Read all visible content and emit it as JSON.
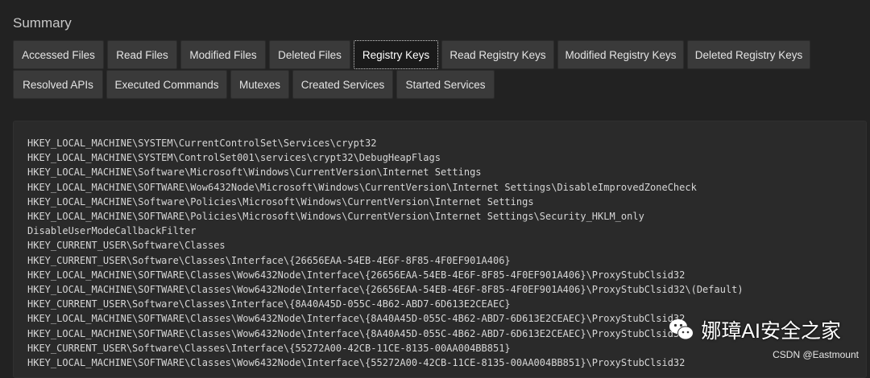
{
  "section": {
    "title": "Summary"
  },
  "tabs": {
    "row1": [
      {
        "label": "Accessed Files"
      },
      {
        "label": "Read Files"
      },
      {
        "label": "Modified Files"
      },
      {
        "label": "Deleted Files"
      },
      {
        "label": "Registry Keys",
        "active": true
      },
      {
        "label": "Read Registry Keys"
      },
      {
        "label": "Modified Registry Keys"
      },
      {
        "label": "Deleted Registry Keys"
      }
    ],
    "row2": [
      {
        "label": "Resolved APIs"
      },
      {
        "label": "Executed Commands"
      },
      {
        "label": "Mutexes"
      },
      {
        "label": "Created Services"
      },
      {
        "label": "Started Services"
      }
    ]
  },
  "registry_keys": [
    "HKEY_LOCAL_MACHINE\\SYSTEM\\CurrentControlSet\\Services\\crypt32",
    "HKEY_LOCAL_MACHINE\\SYSTEM\\ControlSet001\\services\\crypt32\\DebugHeapFlags",
    "HKEY_LOCAL_MACHINE\\Software\\Microsoft\\Windows\\CurrentVersion\\Internet Settings",
    "HKEY_LOCAL_MACHINE\\SOFTWARE\\Wow6432Node\\Microsoft\\Windows\\CurrentVersion\\Internet Settings\\DisableImprovedZoneCheck",
    "HKEY_LOCAL_MACHINE\\Software\\Policies\\Microsoft\\Windows\\CurrentVersion\\Internet Settings",
    "HKEY_LOCAL_MACHINE\\SOFTWARE\\Policies\\Microsoft\\Windows\\CurrentVersion\\Internet Settings\\Security_HKLM_only",
    "DisableUserModeCallbackFilter",
    "HKEY_CURRENT_USER\\Software\\Classes",
    "HKEY_CURRENT_USER\\Software\\Classes\\Interface\\{26656EAA-54EB-4E6F-8F85-4F0EF901A406}",
    "HKEY_LOCAL_MACHINE\\SOFTWARE\\Classes\\Wow6432Node\\Interface\\{26656EAA-54EB-4E6F-8F85-4F0EF901A406}\\ProxyStubClsid32",
    "HKEY_LOCAL_MACHINE\\SOFTWARE\\Classes\\Wow6432Node\\Interface\\{26656EAA-54EB-4E6F-8F85-4F0EF901A406}\\ProxyStubClsid32\\(Default)",
    "HKEY_CURRENT_USER\\Software\\Classes\\Interface\\{8A40A45D-055C-4B62-ABD7-6D613E2CEAEC}",
    "HKEY_LOCAL_MACHINE\\SOFTWARE\\Classes\\Wow6432Node\\Interface\\{8A40A45D-055C-4B62-ABD7-6D613E2CEAEC}\\ProxyStubClsid32",
    "HKEY_LOCAL_MACHINE\\SOFTWARE\\Classes\\Wow6432Node\\Interface\\{8A40A45D-055C-4B62-ABD7-6D613E2CEAEC}\\ProxyStubClsid32",
    "HKEY_CURRENT_USER\\Software\\Classes\\Interface\\{55272A00-42CB-11CE-8135-00AA004BB851}",
    "HKEY_LOCAL_MACHINE\\SOFTWARE\\Classes\\Wow6432Node\\Interface\\{55272A00-42CB-11CE-8135-00AA004BB851}\\ProxyStubClsid32"
  ],
  "watermark": {
    "text": "娜璋AI安全之家",
    "icon": "wechat-icon"
  },
  "credit": {
    "text": "CSDN @Eastmount"
  }
}
